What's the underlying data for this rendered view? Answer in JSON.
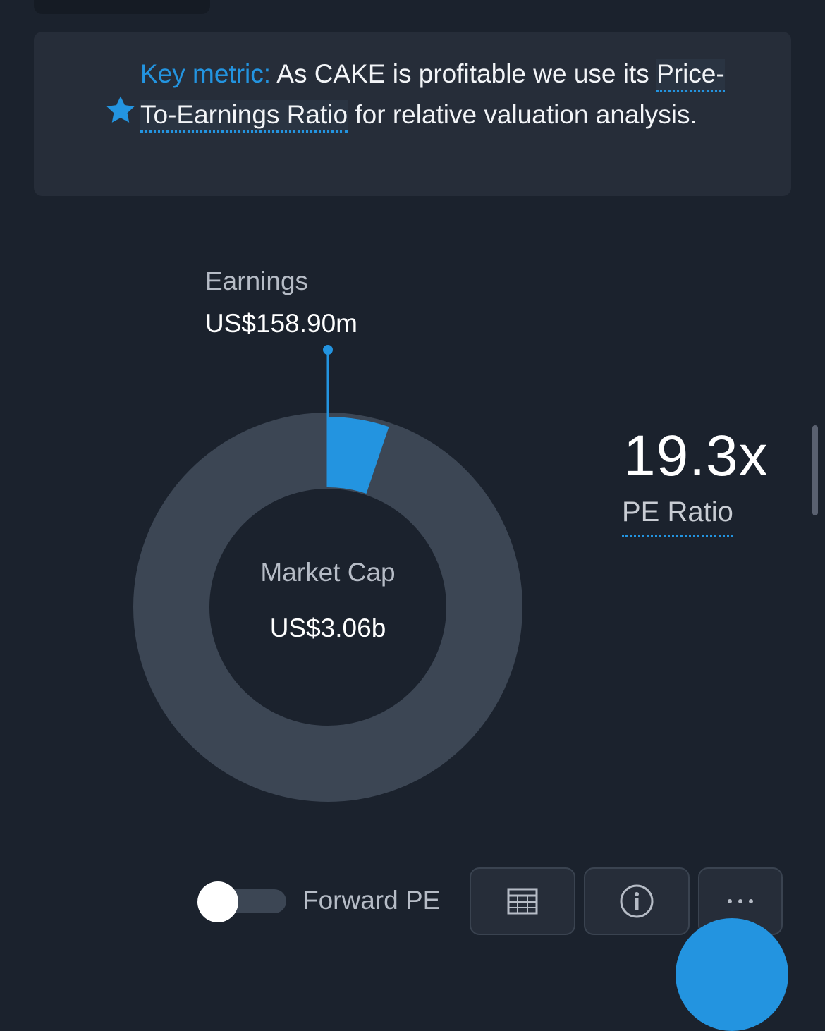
{
  "key_metric": {
    "label": "Key metric:",
    "text_before": " As CAKE is profitable we use its ",
    "link": "Price-To-Earnings Ratio",
    "text_after": " for relative valuation analysis."
  },
  "chart_data": {
    "type": "pie",
    "style": "donut",
    "slices": [
      {
        "name": "Earnings",
        "value": 158.9,
        "unit": "US$m",
        "color": "#2394e0"
      },
      {
        "name": "Market Cap",
        "value": 3060,
        "unit": "US$m",
        "color": "#3c4654"
      }
    ],
    "earnings": {
      "title": "Earnings",
      "value": "US$158.90m"
    },
    "market_cap": {
      "title": "Market Cap",
      "value": "US$3.06b"
    }
  },
  "pe": {
    "value": "19.3x",
    "label": "PE Ratio"
  },
  "controls": {
    "toggle_label": "Forward PE",
    "toggle_on": false,
    "buttons": [
      {
        "icon": "table-icon"
      },
      {
        "icon": "info-icon"
      },
      {
        "icon": "more-icon"
      }
    ]
  },
  "colors": {
    "background": "#1b222d",
    "card": "#262d39",
    "accent": "#2394e0",
    "ring": "#3c4654"
  }
}
